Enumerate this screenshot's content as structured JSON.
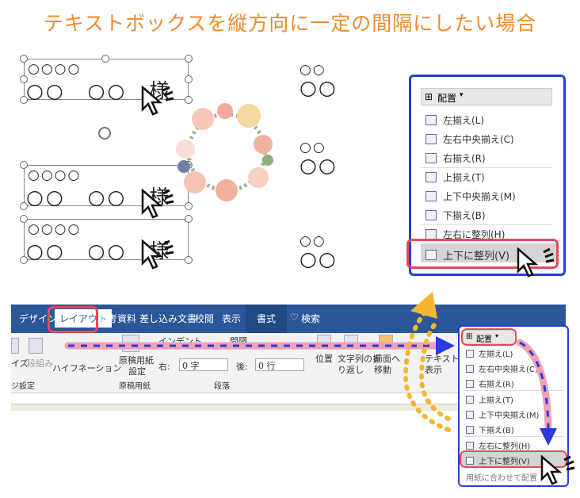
{
  "title": "テキストボックスを縦方向に一定の間隔にしたい場合",
  "doc": {
    "line1": "○○○○",
    "name_line": "○○　○○　様",
    "right_line1": "○○",
    "right_line2": "○○"
  },
  "top_menu": {
    "header": "配置",
    "items": [
      "左揃え(L)",
      "左右中央揃え(C)",
      "右揃え(R)",
      "上揃え(T)",
      "上下中央揃え(M)",
      "下揃え(B)",
      "左右に整列(H)",
      "上下に整列(V)"
    ]
  },
  "ribbon": {
    "tabs": [
      "デザイン",
      "レイアウト",
      "参考資料",
      "差し込み文書",
      "校閲",
      "表示",
      "書式",
      "検索"
    ],
    "indent_label": "インデント",
    "spacing_label": "間隔",
    "indent_right_label": "右:",
    "indent_value": "0 字",
    "spacing_after_label": "後:",
    "spacing_value": "0 行",
    "size_label": "イズ",
    "columns_label": "段組み",
    "hyphenation_label": "ハイフネーション",
    "manuscript_label": "原稿用紙",
    "manuscript_setting": "設定",
    "manuscript_group": "原稿用紙",
    "page_setup_group": "ジ設定",
    "paragraph_group": "段落",
    "position_label": "位置",
    "wrap_label1": "文字列の折",
    "wrap_label2": "り返し",
    "forward_label": "前面へ",
    "forward_label2": "移動",
    "text_label": "テキスト",
    "show_label": "表示"
  },
  "bottom_menu": {
    "header": "配置",
    "items": [
      "左揃え(L)",
      "左右中央揃え(C)",
      "右揃え(R)",
      "上揃え(T)",
      "上下中央揃え(M)",
      "下揃え(B)",
      "左右に整列(H)",
      "上下に整列(V)",
      "用紙に合わせて配置"
    ]
  },
  "colors": {
    "title": "#f08a2c",
    "frame_blue": "#2a3bd9",
    "frame_red": "#e54a5a",
    "ribbon_blue": "#2b579a",
    "path_pink": "#f4a0b8",
    "path_orange": "#f5b733"
  }
}
